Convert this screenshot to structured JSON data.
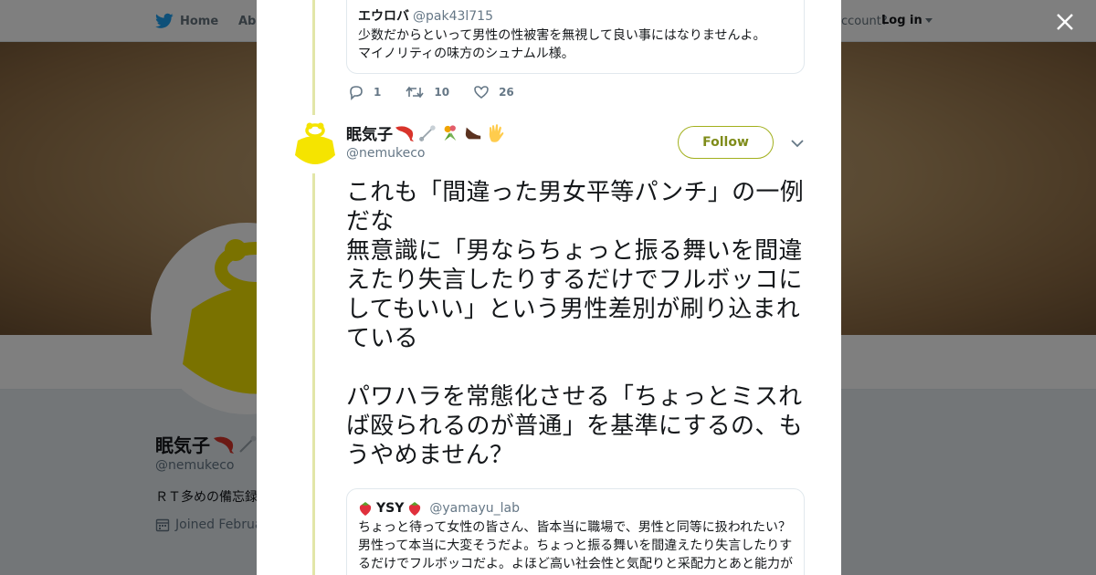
{
  "nav": {
    "home_label": "Home",
    "about_label": "Abo",
    "account_prompt": "ccount?",
    "login_label": "Log in"
  },
  "profile": {
    "name": "眠気子",
    "handle": "@nemukeco",
    "bio": "ＲＴ多めの備忘録",
    "joined": "Joined Februa"
  },
  "prev_tweet": {
    "quote": {
      "name": "エウロバ",
      "handle": "@pak43l715",
      "text": "少数だからといって男性の性被害を無視して良い事にはなりませんよ。\nマイノリティの味方のシュナムル様。"
    },
    "replies": "1",
    "retweets": "10",
    "likes": "26"
  },
  "tweet": {
    "name": "眠気子",
    "name_emoji": [
      "shrimp-icon",
      "safety-pin-icon",
      "bouquet-icon",
      "shoe-icon",
      "hand-icon"
    ],
    "handle": "@nemukeco",
    "follow_label": "Follow",
    "text": "これも「間違った男女平等パンチ」の一例だな\n無意識に「男ならちょっと振る舞いを間違えたり失言したりするだけでフルボッコにしてもいい」という男性差別が刷り込まれている\n\nパワハラを常態化させる「ちょっとミスれば殴られるのが普通」を基準にするの、もうやめません？",
    "quote": {
      "name": "YSY",
      "handle": "@yamayu_lab",
      "text": "ちょっと待って女性の皆さん、皆本当に職場で、男性と同等に扱われたい？\n男性って本当に大変そうだよ。ちょっと振る舞いを間違えたり失言したりするだけでフルボッコだよ。よほど高い社会性と気配りと采配力とあと能力が"
    }
  },
  "colors": {
    "accent": "#a2b01d",
    "twitter_blue": "#1da1f2",
    "avatar_yellow": "#f5e400"
  }
}
